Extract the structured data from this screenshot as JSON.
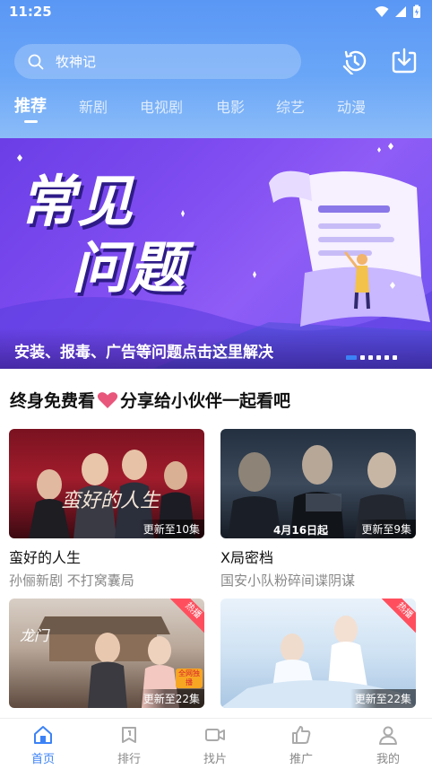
{
  "status_bar": {
    "time": "11:25"
  },
  "search": {
    "placeholder": "牧神记"
  },
  "tabs": [
    {
      "label": "推荐"
    },
    {
      "label": "新剧"
    },
    {
      "label": "电视剧"
    },
    {
      "label": "电影"
    },
    {
      "label": "综艺"
    },
    {
      "label": "动漫"
    }
  ],
  "banner": {
    "title_line1": "常见",
    "title_line2": "问题",
    "caption": "安装、报毒、广告等问题点击这里解决"
  },
  "section": {
    "title_part1": "终身免费看",
    "title_part2": "分享给小伙伴一起看吧"
  },
  "cards": [
    {
      "title": "蛮好的人生",
      "subtitle": "孙俪新剧 不打窝囊局",
      "badge": "更新至10集",
      "poster_text": "蛮好的人生"
    },
    {
      "title": "X局密档",
      "subtitle": "国安小队粉碎间谍阴谋",
      "badge": "更新至9集",
      "poster_text": "4月16日起"
    },
    {
      "badge": "更新至22集",
      "hot": "热播",
      "poster_text": "全网独播"
    },
    {
      "badge": "更新至22集",
      "hot": "热播"
    }
  ],
  "bottom_nav": [
    {
      "label": "首页"
    },
    {
      "label": "排行"
    },
    {
      "label": "找片"
    },
    {
      "label": "推广"
    },
    {
      "label": "我的"
    }
  ],
  "colors": {
    "accent": "#3b82f6",
    "header": "#5a97f5",
    "banner": "#7e4cf0",
    "hot": "#ff4f5e"
  }
}
